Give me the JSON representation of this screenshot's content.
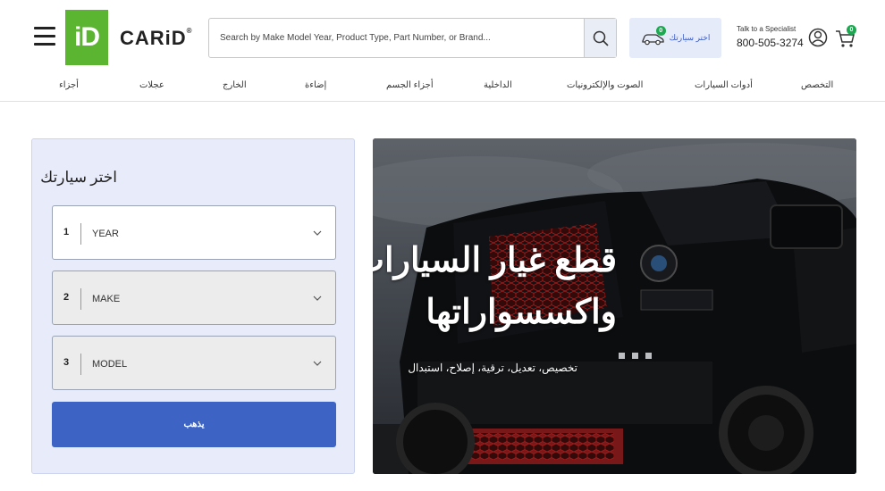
{
  "header": {
    "logo_mark": "iD",
    "logo_text": "CARiD",
    "logo_reg": "®",
    "search_placeholder": "Search by Make Model Year, Product Type, Part Number, or Brand...",
    "vehicle_button_label": "اختر سيارتك",
    "vehicle_count": "0",
    "specialist_label": "Talk to a Specialist",
    "specialist_phone": "800-505-3274",
    "cart_count": "0"
  },
  "nav": {
    "items": [
      {
        "label": "التخصص"
      },
      {
        "label": "أدوات السيارات"
      },
      {
        "label": "الصوت والإلكترونيات"
      },
      {
        "label": "الداخلية"
      },
      {
        "label": "أجزاء الجسم"
      },
      {
        "label": "إضاءة"
      },
      {
        "label": "الخارج"
      },
      {
        "label": "عجلات"
      },
      {
        "label": "أجزاء"
      }
    ]
  },
  "selector": {
    "title": "اختر سيارتك",
    "fields": [
      {
        "num": "1",
        "label": "YEAR"
      },
      {
        "num": "2",
        "label": "MAKE"
      },
      {
        "num": "3",
        "label": "MODEL"
      }
    ],
    "go_label": "يذهب"
  },
  "hero": {
    "title_line1": "قطع غيار السيارات",
    "title_line2": "واكسسواراتها",
    "subtitle": "تخصيص، تعديل، ترقية، إصلاح، استبدال"
  },
  "colors": {
    "brand_green": "#5cb531",
    "accent_blue": "#3d64c4",
    "badge_green": "#1da851",
    "selector_bg": "#e8ecfa"
  }
}
